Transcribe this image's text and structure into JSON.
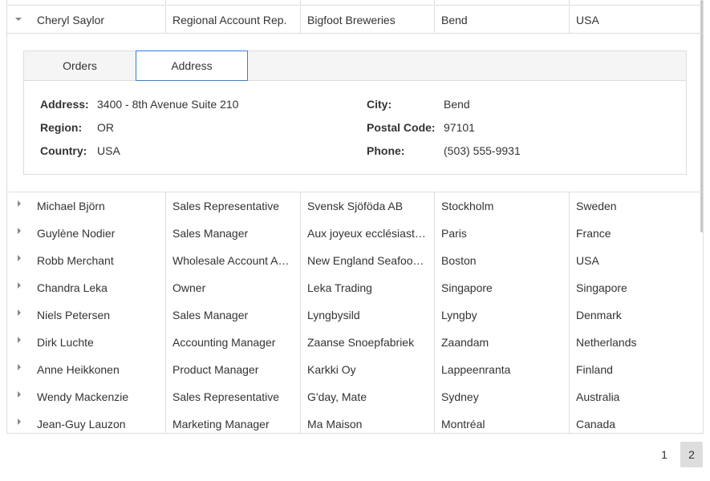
{
  "expanded": {
    "name": "Cheryl Saylor",
    "title": "Regional Account Rep.",
    "company": "Bigfoot Breweries",
    "city": "Bend",
    "country": "USA"
  },
  "detail_tabs": [
    {
      "label": "Orders"
    },
    {
      "label": "Address"
    }
  ],
  "address": {
    "address_label": "Address:",
    "address_value": "3400 - 8th Avenue Suite 210",
    "region_label": "Region:",
    "region_value": "OR",
    "country_label": "Country:",
    "country_value": "USA",
    "city_label": "City:",
    "city_value": "Bend",
    "postal_label": "Postal Code:",
    "postal_value": "97101",
    "phone_label": "Phone:",
    "phone_value": "(503) 555-9931"
  },
  "rows": [
    {
      "name": "Michael Björn",
      "title": "Sales Representative",
      "company": "Svensk Sjöföda AB",
      "city": "Stockholm",
      "country": "Sweden"
    },
    {
      "name": "Guylène Nodier",
      "title": "Sales Manager",
      "company": "Aux joyeux ecclésiastiques",
      "city": "Paris",
      "country": "France"
    },
    {
      "name": "Robb Merchant",
      "title": "Wholesale Account Agent",
      "company": "New England Seafood Cannery",
      "city": "Boston",
      "country": "USA"
    },
    {
      "name": "Chandra Leka",
      "title": "Owner",
      "company": "Leka Trading",
      "city": "Singapore",
      "country": "Singapore"
    },
    {
      "name": "Niels Petersen",
      "title": "Sales Manager",
      "company": "Lyngbysild",
      "city": "Lyngby",
      "country": "Denmark"
    },
    {
      "name": "Dirk Luchte",
      "title": "Accounting Manager",
      "company": "Zaanse Snoepfabriek",
      "city": "Zaandam",
      "country": "Netherlands"
    },
    {
      "name": "Anne Heikkonen",
      "title": "Product Manager",
      "company": "Karkki Oy",
      "city": "Lappeenranta",
      "country": "Finland"
    },
    {
      "name": "Wendy Mackenzie",
      "title": "Sales Representative",
      "company": "G'day, Mate",
      "city": "Sydney",
      "country": "Australia"
    },
    {
      "name": "Jean-Guy Lauzon",
      "title": "Marketing Manager",
      "company": "Ma Maison",
      "city": "Montréal",
      "country": "Canada"
    }
  ],
  "pager": {
    "pages": [
      "1",
      "2"
    ],
    "current": "2"
  },
  "icons": {
    "expanded_toggle": "caret-down-icon",
    "collapsed_toggle": "caret-right-icon"
  }
}
